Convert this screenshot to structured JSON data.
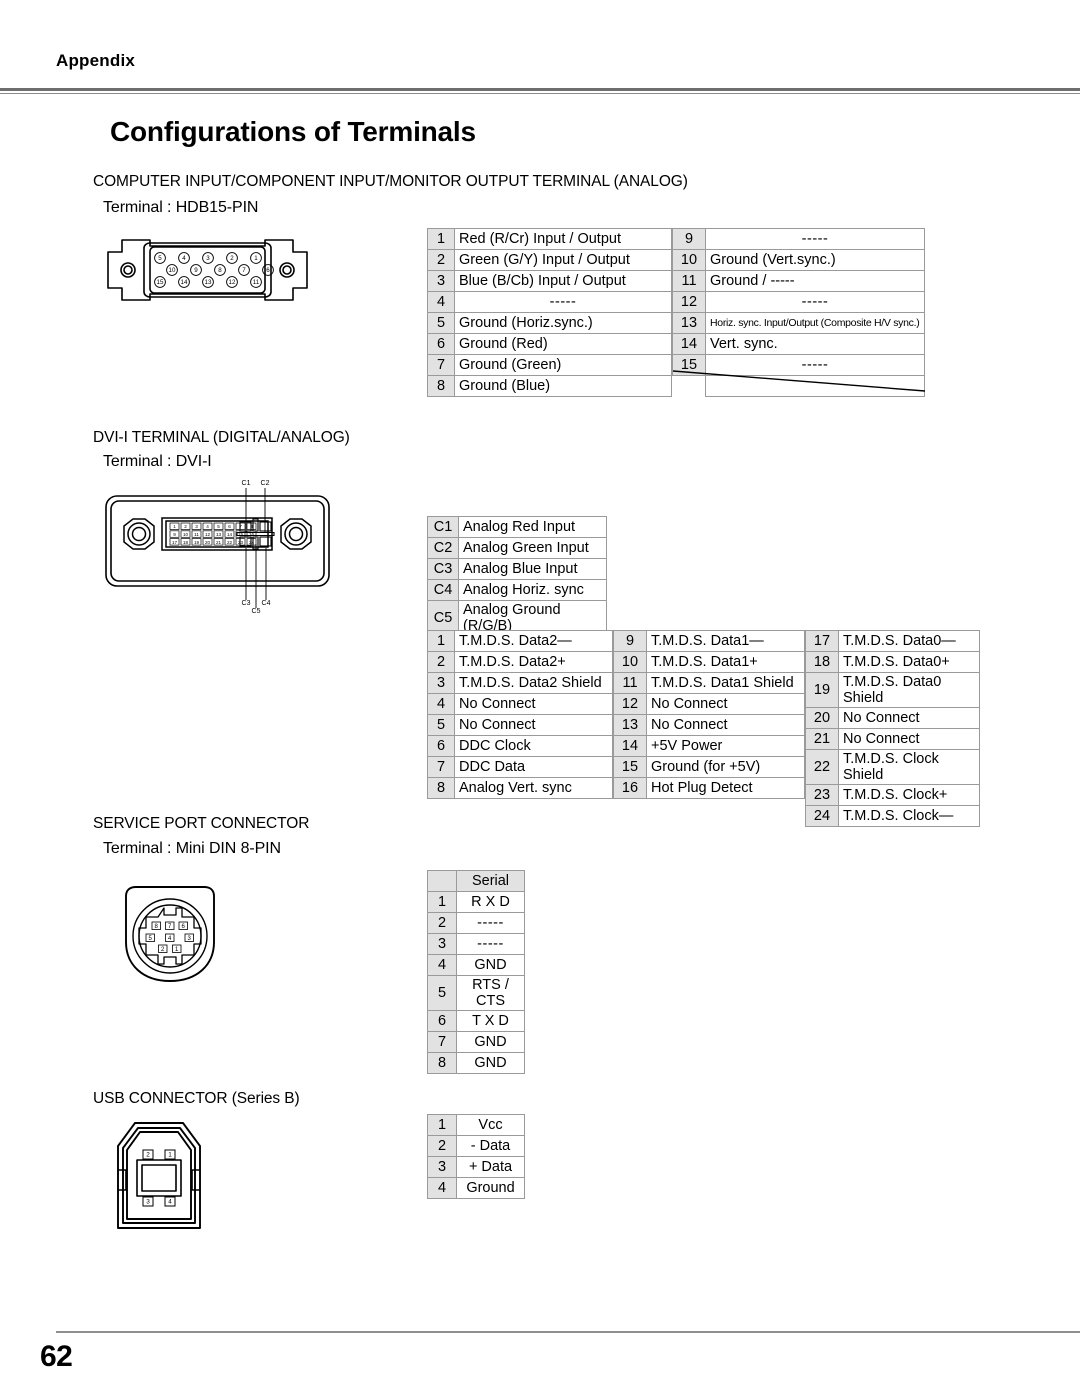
{
  "header": {
    "running_head": "Appendix"
  },
  "title": "Configurations of Terminals",
  "sections": {
    "analog": {
      "heading": "COMPUTER INPUT/COMPONENT INPUT/MONITOR OUTPUT TERMINAL (ANALOG)",
      "terminal": "Terminal : HDB15-PIN",
      "connector_icon": "hdb15-connector-icon",
      "connector_pin_rows": [
        [
          "5",
          "4",
          "3",
          "2",
          "1"
        ],
        [
          "10",
          "9",
          "8",
          "7",
          "6"
        ],
        [
          "15",
          "14",
          "13",
          "12",
          "11"
        ]
      ],
      "table_left": [
        {
          "pin": "1",
          "signal": "Red (R/Cr) Input / Output"
        },
        {
          "pin": "2",
          "signal": "Green (G/Y) Input / Output"
        },
        {
          "pin": "3",
          "signal": "Blue (B/Cb) Input / Output"
        },
        {
          "pin": "4",
          "signal": "-----"
        },
        {
          "pin": "5",
          "signal": "Ground (Horiz.sync.)"
        },
        {
          "pin": "6",
          "signal": "Ground (Red)"
        },
        {
          "pin": "7",
          "signal": "Ground (Green)"
        },
        {
          "pin": "8",
          "signal": "Ground (Blue)"
        }
      ],
      "table_right": [
        {
          "pin": "9",
          "signal": "-----"
        },
        {
          "pin": "10",
          "signal": "Ground (Vert.sync.)"
        },
        {
          "pin": "11",
          "signal": "Ground /  -----"
        },
        {
          "pin": "12",
          "signal": "-----"
        },
        {
          "pin": "13",
          "signal": "Horiz. sync. Input/Output (Composite H/V sync.)"
        },
        {
          "pin": "14",
          "signal": "Vert. sync."
        },
        {
          "pin": "15",
          "signal": "-----"
        }
      ]
    },
    "dvi": {
      "heading": "DVI-I TERMINAL (DIGITAL/ANALOG)",
      "terminal": "Terminal : DVI-I",
      "connector_icon": "dvi-i-connector-icon",
      "callouts_top": [
        "C1",
        "C2"
      ],
      "callouts_bottom": [
        "C3",
        "C4"
      ],
      "callout_center": "C5",
      "connector_pin_rows": [
        [
          "1",
          "2",
          "3",
          "4",
          "5",
          "6",
          "7",
          "8"
        ],
        [
          "9",
          "10",
          "11",
          "12",
          "13",
          "14",
          "15",
          "16"
        ],
        [
          "17",
          "18",
          "19",
          "20",
          "21",
          "22",
          "23",
          "24"
        ]
      ],
      "analog_table": [
        {
          "pin": "C1",
          "signal": "Analog Red Input"
        },
        {
          "pin": "C2",
          "signal": "Analog Green Input"
        },
        {
          "pin": "C3",
          "signal": "Analog Blue Input"
        },
        {
          "pin": "C4",
          "signal": "Analog Horiz. sync"
        },
        {
          "pin": "C5",
          "signal": "Analog Ground (R/G/B)"
        }
      ],
      "digital_table": {
        "col1": [
          {
            "pin": "1",
            "signal": "T.M.D.S. Data2—"
          },
          {
            "pin": "2",
            "signal": "T.M.D.S. Data2+"
          },
          {
            "pin": "3",
            "signal": "T.M.D.S. Data2 Shield"
          },
          {
            "pin": "4",
            "signal": "No Connect"
          },
          {
            "pin": "5",
            "signal": "No Connect"
          },
          {
            "pin": "6",
            "signal": "DDC Clock"
          },
          {
            "pin": "7",
            "signal": "DDC Data"
          },
          {
            "pin": "8",
            "signal": "Analog Vert. sync"
          }
        ],
        "col2": [
          {
            "pin": "9",
            "signal": "T.M.D.S. Data1—"
          },
          {
            "pin": "10",
            "signal": "T.M.D.S. Data1+"
          },
          {
            "pin": "11",
            "signal": "T.M.D.S. Data1 Shield"
          },
          {
            "pin": "12",
            "signal": "No Connect"
          },
          {
            "pin": "13",
            "signal": "No Connect"
          },
          {
            "pin": "14",
            "signal": "+5V Power"
          },
          {
            "pin": "15",
            "signal": "Ground (for +5V)"
          },
          {
            "pin": "16",
            "signal": "Hot Plug Detect"
          }
        ],
        "col3": [
          {
            "pin": "17",
            "signal": "T.M.D.S. Data0—"
          },
          {
            "pin": "18",
            "signal": "T.M.D.S. Data0+"
          },
          {
            "pin": "19",
            "signal": "T.M.D.S. Data0 Shield"
          },
          {
            "pin": "20",
            "signal": "No Connect"
          },
          {
            "pin": "21",
            "signal": "No Connect"
          },
          {
            "pin": "22",
            "signal": "T.M.D.S. Clock Shield"
          },
          {
            "pin": "23",
            "signal": "T.M.D.S. Clock+"
          },
          {
            "pin": "24",
            "signal": "T.M.D.S. Clock—"
          }
        ]
      }
    },
    "service": {
      "heading": "SERVICE PORT CONNECTOR",
      "terminal": "Terminal : Mini DIN 8-PIN",
      "connector_icon": "mini-din-8pin-connector-icon",
      "connector_pin_rows": [
        [
          "8",
          "7",
          "6"
        ],
        [
          "5",
          "4",
          "3"
        ],
        [
          "2",
          "1"
        ]
      ],
      "table_header": "Serial",
      "table": [
        {
          "pin": "1",
          "signal": "R X D"
        },
        {
          "pin": "2",
          "signal": "-----"
        },
        {
          "pin": "3",
          "signal": "-----"
        },
        {
          "pin": "4",
          "signal": "GND"
        },
        {
          "pin": "5",
          "signal": "RTS / CTS"
        },
        {
          "pin": "6",
          "signal": "T X D"
        },
        {
          "pin": "7",
          "signal": "GND"
        },
        {
          "pin": "8",
          "signal": "GND"
        }
      ]
    },
    "usb": {
      "heading": "USB CONNECTOR (Series B)",
      "connector_icon": "usb-series-b-connector-icon",
      "connector_pins_top": [
        "2",
        "1"
      ],
      "connector_pins_bottom": [
        "3",
        "4"
      ],
      "table": [
        {
          "pin": "1",
          "signal": "Vcc"
        },
        {
          "pin": "2",
          "signal": "- Data"
        },
        {
          "pin": "3",
          "signal": "+ Data"
        },
        {
          "pin": "4",
          "signal": "Ground"
        }
      ]
    }
  },
  "footer": {
    "page_number": "62"
  },
  "colors": {
    "pin_cell_fill": "#e2e2e2",
    "rule": "#8a8a8a",
    "text": "#000000"
  }
}
